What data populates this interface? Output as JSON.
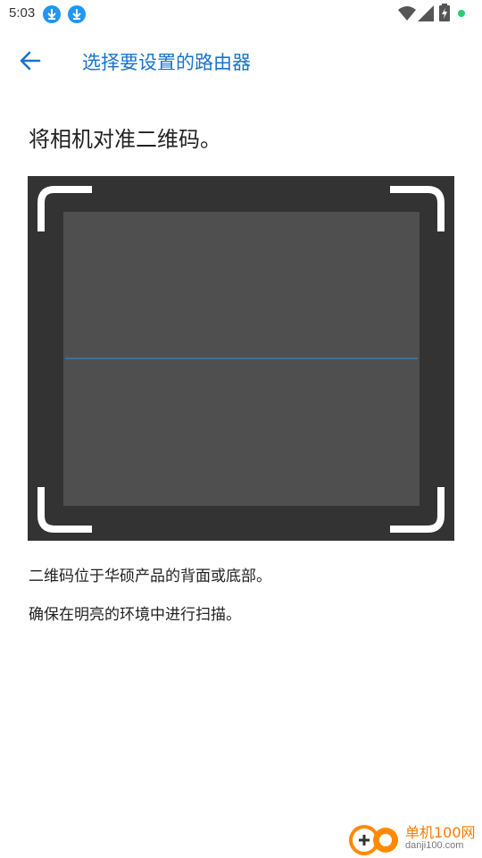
{
  "status_bar": {
    "time": "5:03",
    "icons": [
      "download-icon",
      "download-icon",
      "wifi-icon",
      "signal-icon",
      "battery-icon",
      "notification-dot-icon"
    ],
    "dot_color": "#2ecc71"
  },
  "app_bar": {
    "back_icon": "arrow-left-icon",
    "title": "选择要设置的路由器",
    "accent": "#1a73c8"
  },
  "main": {
    "headline": "将相机对准二维码。",
    "scanner": {
      "frame_color": "#333333",
      "viewport_color": "#4f4f4f",
      "scan_line_color": "#3f6f96",
      "corner_color": "#ffffff"
    },
    "notes": [
      "二维码位于华硕产品的背面或底部。",
      "确保在明亮的环境中进行扫描。"
    ]
  },
  "watermark": {
    "logo_icon": "danji-logo-icon",
    "name": "单机100网",
    "url": "danji100.com"
  }
}
